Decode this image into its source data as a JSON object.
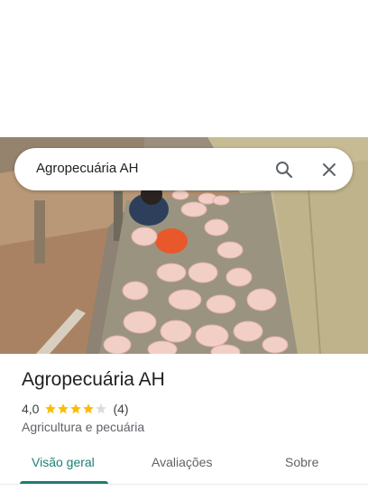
{
  "search": {
    "query": "Agropecuária AH",
    "search_icon": "search-icon",
    "close_icon": "close-icon"
  },
  "hero": {
    "photo": "pigs-photo"
  },
  "place": {
    "name": "Agropecuária AH",
    "rating_value": "4,0",
    "rating": 4.0,
    "stars_max": 5,
    "review_count": "(4)",
    "category": "Agricultura e pecuária"
  },
  "tabs": [
    {
      "label": "Visão geral",
      "active": true
    },
    {
      "label": "Avaliações",
      "active": false
    },
    {
      "label": "Sobre",
      "active": false
    }
  ],
  "colors": {
    "accent": "#1a7f75",
    "star": "#fbbc04",
    "star_empty": "#dadce0"
  }
}
